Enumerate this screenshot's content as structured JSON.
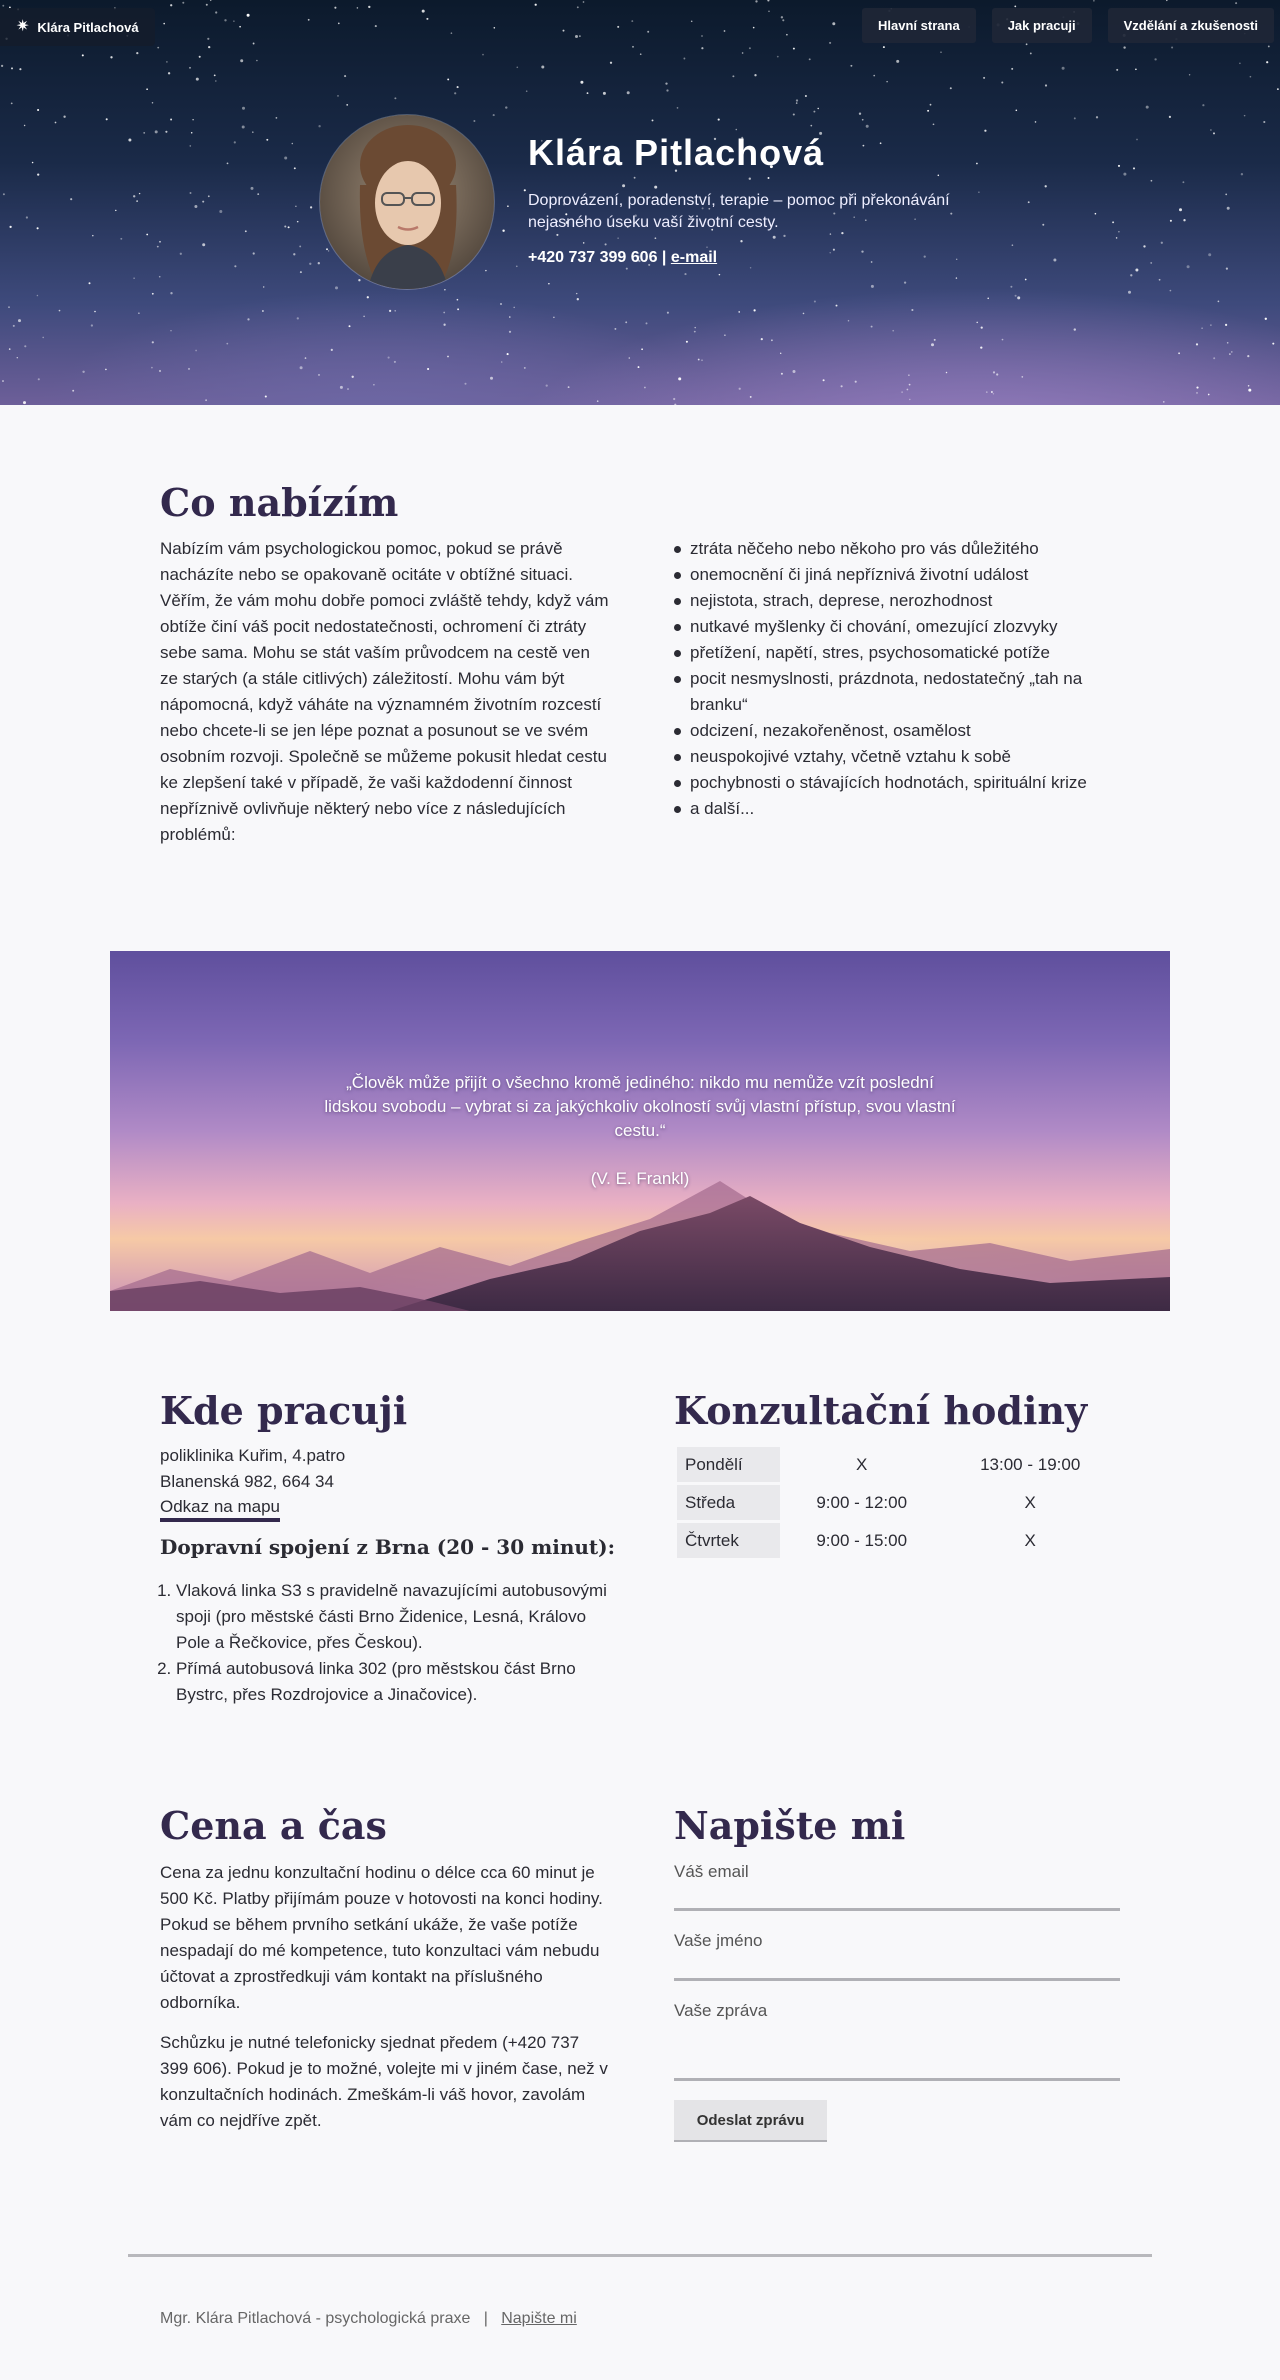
{
  "nav": {
    "brand": "Klára Pitlachová",
    "items": [
      "Hlavní strana",
      "Jak pracuji",
      "Vzdělání a zkušenosti"
    ]
  },
  "hero": {
    "name": "Klára Pitlachová",
    "subtitle": "Doprovázení, poradenství, terapie – pomoc při překonávání nejasného úseku vaší životní cesty.",
    "phone": "+420 737 399 606",
    "separator": "|",
    "email_label": "e-mail"
  },
  "offer": {
    "title": "Co nabízím",
    "text": "Nabízím vám psychologickou pomoc, pokud se právě nacházíte nebo se opakovaně ocitáte v obtížné situaci. Věřím, že vám mohu dobře pomoci zvláště tehdy, když vám obtíže činí váš pocit nedostatečnosti, ochromení či ztráty sebe sama. Mohu se stát vaším průvodcem na cestě ven ze starých (a stále citlivých) záležitostí. Mohu vám být nápomocná, když váháte na významném životním rozcestí nebo chcete-li se jen lépe poznat a posunout se ve svém osobním rozvoji. Společně se můžeme pokusit hledat cestu ke zlepšení také v případě, že vaši každodenní činnost nepříznivě ovlivňuje některý nebo více z následujících problémů:",
    "items": [
      "ztráta něčeho nebo někoho pro vás důležitého",
      "onemocnění či jiná nepříznivá životní událost",
      "nejistota, strach, deprese, nerozhodnost",
      "nutkavé myšlenky či chování, omezující zlozvyky",
      "přetížení, napětí, stres, psychosomatické potíže",
      "pocit nesmyslnosti, prázdnota, nedostatečný „tah na branku“",
      "odcizení, nezakořeněnost, osamělost",
      "neuspokojivé vztahy, včetně vztahu k sobě",
      "pochybnosti o stávajících hodnotách, spirituální krize",
      "a další..."
    ]
  },
  "quote": {
    "text": "„Člověk může přijít o všechno kromě jediného: nikdo mu nemůže vzít poslední lidskou svobodu – vybrat si za jakýchkoliv okolností svůj vlastní přístup, svou vlastní cestu.“",
    "author": "(V. E. Frankl)"
  },
  "where": {
    "title": "Kde pracuji",
    "address_line1": "poliklinika Kuřim, 4.patro",
    "address_line2": "Blanenská 982, 664 34",
    "map_link": "Odkaz na mapu",
    "transport_title": "Dopravní spojení z Brna (20 - 30 minut):",
    "transport": [
      "Vlaková linka S3 s pravidelně navazujícími autobusovými spoji (pro městské části Brno Židenice, Lesná, Královo Pole a Řečkovice, přes Českou).",
      "Přímá autobusová linka 302 (pro městskou část Brno Bystrc, přes Rozdrojovice a Jinačovice)."
    ]
  },
  "hours": {
    "title": "Konzultační hodiny",
    "rows": [
      {
        "day": "Pondělí",
        "a": "X",
        "b": "13:00 - 19:00"
      },
      {
        "day": "Středa",
        "a": "9:00 - 12:00",
        "b": "X"
      },
      {
        "day": "Čtvrtek",
        "a": "9:00 - 15:00",
        "b": "X"
      }
    ]
  },
  "price": {
    "title": "Cena a čas",
    "p1": "Cena za jednu konzultační hodinu o délce cca 60 minut je 500 Kč. Platby přijímám pouze v hotovosti na konci hodiny. Pokud se během prvního setkání ukáže, že vaše potíže nespadají do mé kompetence, tuto konzultaci vám nebudu účtovat a zprostředkuji vám kontakt na příslušného odborníka.",
    "p2": "Schůzku je nutné telefonicky sjednat předem (+420 737 399 606). Pokud je to možné, volejte mi v jiném čase, než v konzultačních hodinách. Zmeškám-li váš hovor, zavolám vám co nejdříve zpět."
  },
  "contact": {
    "title": "Napište mi",
    "email_label": "Váš email",
    "name_label": "Vaše jméno",
    "message_label": "Vaše zpráva",
    "submit": "Odeslat zprávu"
  },
  "footer": {
    "text": "Mgr. Klára Pitlachová - psychologická praxe",
    "separator": "|",
    "link": "Napište mi"
  }
}
